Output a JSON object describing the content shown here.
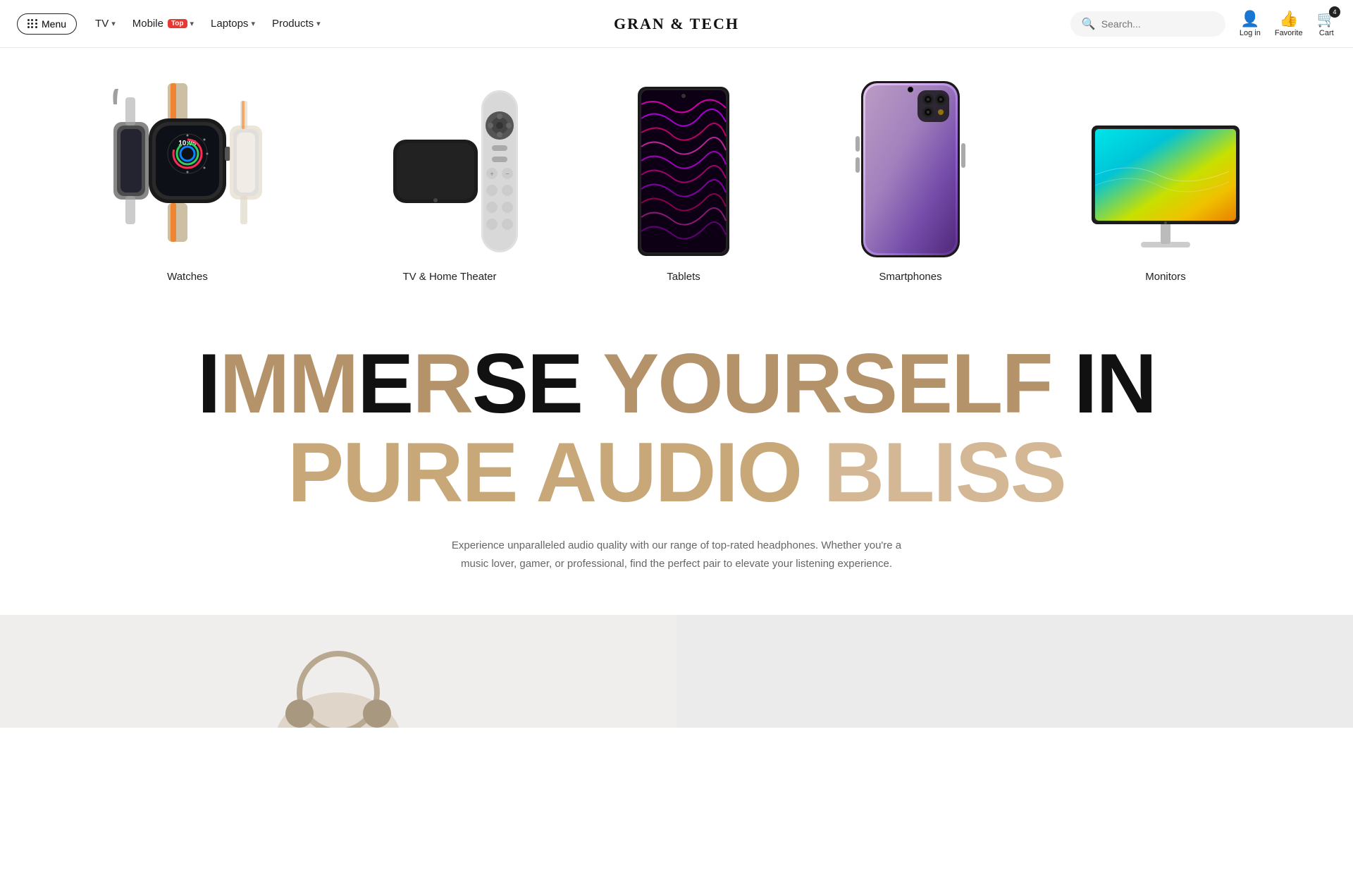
{
  "navbar": {
    "menu_label": "Menu",
    "brand": "Gran & Tech",
    "links": [
      {
        "label": "TV",
        "has_dropdown": true,
        "badge": null
      },
      {
        "label": "Mobile",
        "has_dropdown": true,
        "badge": "Top"
      },
      {
        "label": "Laptops",
        "has_dropdown": true,
        "badge": null
      },
      {
        "label": "Products",
        "has_dropdown": true,
        "badge": null
      }
    ],
    "search_placeholder": "Search...",
    "login_label": "Log in",
    "favorite_label": "Favorite",
    "cart_label": "Cart",
    "cart_count": "4"
  },
  "categories": [
    {
      "label": "Watches",
      "type": "watch"
    },
    {
      "label": "TV & Home Theater",
      "type": "tv"
    },
    {
      "label": "Tablets",
      "type": "tablet"
    },
    {
      "label": "Smartphones",
      "type": "phone"
    },
    {
      "label": "Monitors",
      "type": "monitor"
    }
  ],
  "hero": {
    "line1": "IMMERSE YOURSELF IN",
    "line2": "PURE AUDIO BLISS",
    "description": "Experience unparalleled audio quality with our range of top-rated headphones. Whether you're a music lover, gamer, or professional, find the perfect pair to elevate your listening experience."
  },
  "accent_color": "#b5936a",
  "light_accent": "#d4b896"
}
